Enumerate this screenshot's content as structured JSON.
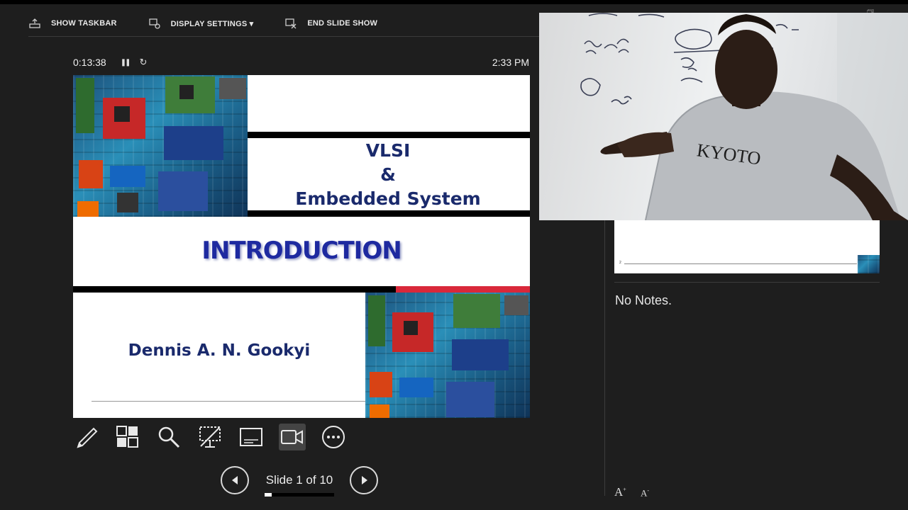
{
  "toolbar": {
    "show_taskbar": "SHOW TASKBAR",
    "display_settings": "DISPLAY SETTINGS ▾",
    "end_slide_show": "END SLIDE SHOW"
  },
  "timer": {
    "elapsed": "0:13:38",
    "pause_icon": "❚❚",
    "restart_icon": "↻",
    "clock": "2:33 PM"
  },
  "slide": {
    "title_line1": "VLSI",
    "title_line2": "&",
    "title_line3": "Embedded System",
    "heading": "INTRODUCTION",
    "author": "Dennis A. N. Gookyi"
  },
  "tools": [
    "pen-icon",
    "slide-grid-icon",
    "zoom-icon",
    "black-screen-icon",
    "subtitles-icon",
    "camera-icon",
    "more-options-icon"
  ],
  "navigation": {
    "slide_count": "Slide 1 of 10",
    "progress": 0.1
  },
  "next_slide": {
    "page_number": "2"
  },
  "notes": {
    "text": "No Notes."
  },
  "font_controls": {
    "increase": "A",
    "decrease": "A"
  },
  "webcam": {
    "shirt_text": "KYOTO"
  },
  "colors": {
    "slide_title": "#1a2a6c",
    "intro": "#1e2aa0",
    "accent_red": "#d9283a",
    "background": "#1e1e1e"
  }
}
